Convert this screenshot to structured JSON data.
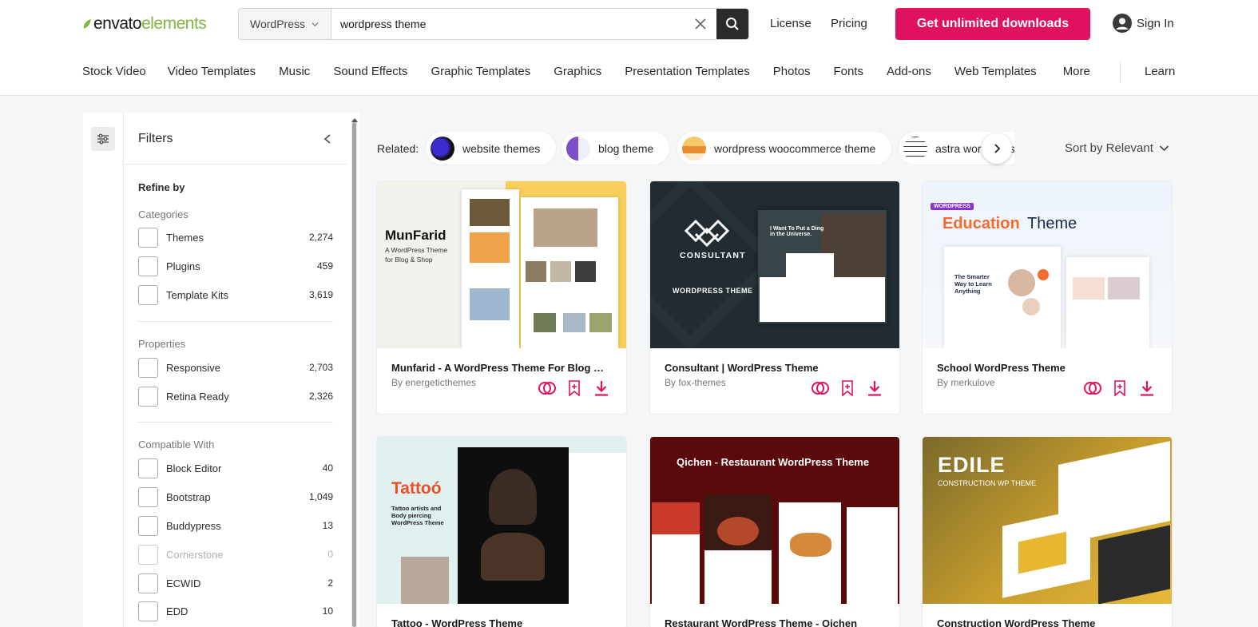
{
  "header": {
    "logo_part1": "envato",
    "logo_part2": "elements",
    "search_scope": "WordPress",
    "search_value": "wordpress theme",
    "links": [
      "License",
      "Pricing"
    ],
    "cta": "Get unlimited downloads",
    "signin": "Sign In"
  },
  "categories": [
    "Stock Video",
    "Video Templates",
    "Music",
    "Sound Effects",
    "Graphic Templates",
    "Graphics",
    "Presentation Templates",
    "Photos",
    "Fonts",
    "Add-ons",
    "Web Templates",
    "More"
  ],
  "learn": "Learn",
  "filters": {
    "title": "Filters",
    "refine": "Refine by",
    "groups": [
      {
        "title": "Categories",
        "items": [
          {
            "label": "Themes",
            "count": "2,274"
          },
          {
            "label": "Plugins",
            "count": "459"
          },
          {
            "label": "Template Kits",
            "count": "3,619"
          }
        ]
      },
      {
        "title": "Properties",
        "items": [
          {
            "label": "Responsive",
            "count": "2,703"
          },
          {
            "label": "Retina Ready",
            "count": "2,326"
          }
        ]
      },
      {
        "title": "Compatible With",
        "items": [
          {
            "label": "Block Editor",
            "count": "40"
          },
          {
            "label": "Bootstrap",
            "count": "1,049"
          },
          {
            "label": "Buddypress",
            "count": "13"
          },
          {
            "label": "Cornerstone",
            "count": "0"
          },
          {
            "label": "ECWID",
            "count": "2"
          },
          {
            "label": "EDD",
            "count": "10"
          }
        ]
      }
    ]
  },
  "related": {
    "label": "Related:",
    "chips": [
      "website themes",
      "blog theme",
      "wordpress woocommerce theme",
      "astra wordpress theme"
    ]
  },
  "sort": "Sort by Relevant",
  "cards": [
    {
      "title": "Munfarid - A WordPress Theme For Blog & Shop",
      "author": "By energeticthemes"
    },
    {
      "title": "Consultant | WordPress Theme",
      "author": "By fox-themes"
    },
    {
      "title": "School WordPress Theme",
      "author": "By merkulove"
    },
    {
      "title": "Tattoo - WordPress Theme",
      "author": ""
    },
    {
      "title": "Restaurant WordPress Theme - Qichen",
      "author": ""
    },
    {
      "title": "Construction WordPress Theme",
      "author": ""
    }
  ],
  "preview_text": {
    "munfarid_name": "MunFarid",
    "munfarid_tag1": "A WordPress Theme",
    "munfarid_tag2": "for Blog & Shop",
    "consultant_name": "CONSULTANT",
    "consultant_sub": "WORDPRESS THEME",
    "consultant_head": "I Want To Put a Ding in the Universe.",
    "edu_badge": "WORDPRESS",
    "edu_title_a": "Education",
    "edu_title_b": "Theme",
    "edu_hero": "The Smarter Way to Learn Anything",
    "tattoo_name": "Tattoó",
    "tattoo_sub": "Tattoo artists and Body piercing WordPress Theme",
    "qichen_title": "Qichen - Restaurant WordPress Theme",
    "edile_name": "EDILE",
    "edile_sub": "CONSTRUCTION WP THEME"
  },
  "colors": {
    "accent": "#e0115f",
    "brand_green": "#82b541",
    "dark_button": "#2b2b2b"
  }
}
